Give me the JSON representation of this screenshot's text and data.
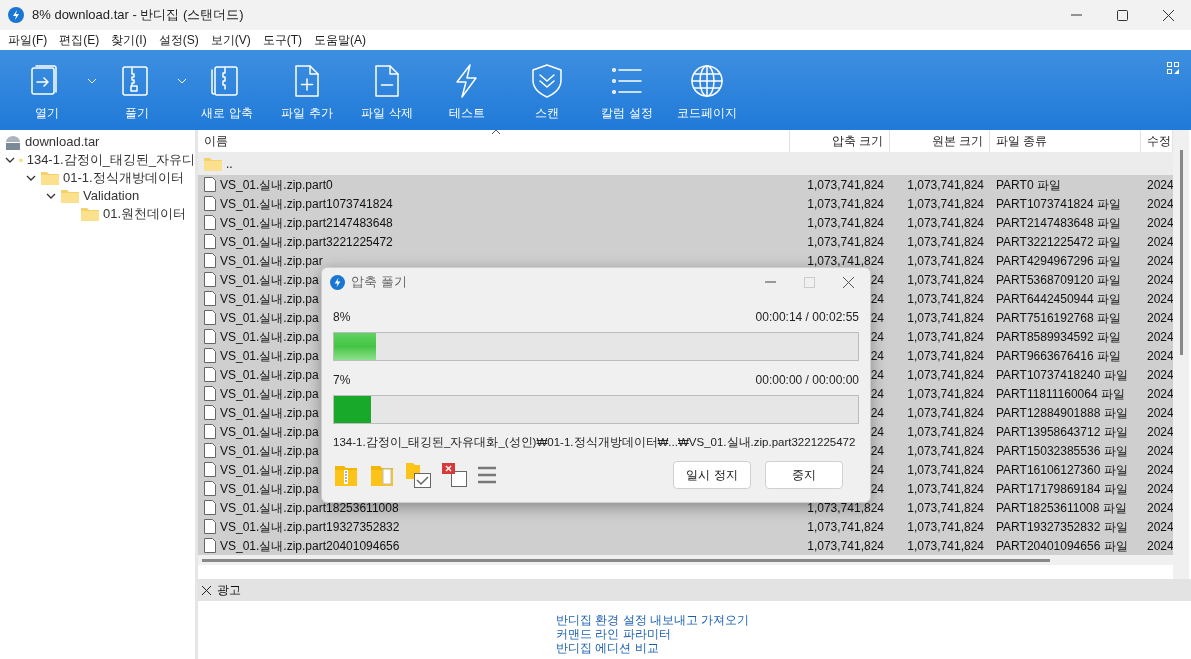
{
  "window": {
    "title": "8% download.tar - 반디집 (스탠더드)"
  },
  "menu": [
    "파일(F)",
    "편집(E)",
    "찾기(I)",
    "설정(S)",
    "보기(V)",
    "도구(T)",
    "도움말(A)"
  ],
  "toolbar": [
    {
      "kind": "open",
      "label": "열기",
      "dropdown": true
    },
    {
      "kind": "extract",
      "label": "풀기",
      "dropdown": true
    },
    {
      "kind": "new",
      "label": "새로 압축",
      "dropdown": false
    },
    {
      "kind": "add",
      "label": "파일 추가",
      "dropdown": false
    },
    {
      "kind": "delete",
      "label": "파일 삭제",
      "dropdown": false
    },
    {
      "kind": "test",
      "label": "테스트",
      "dropdown": false
    },
    {
      "kind": "scan",
      "label": "스캔",
      "dropdown": false
    },
    {
      "kind": "columns",
      "label": "칼럼 설정",
      "dropdown": false
    },
    {
      "kind": "codepage",
      "label": "코드페이지",
      "dropdown": false
    }
  ],
  "tree": {
    "label": "download.tar",
    "children": [
      {
        "label": "134-1.감정이_태깅된_자유디",
        "expanded": true,
        "children": [
          {
            "label": "01-1.정식개방데이터",
            "expanded": true,
            "children": [
              {
                "label": "Validation",
                "expanded": true,
                "children": [
                  {
                    "label": "01.원천데이터"
                  }
                ]
              }
            ]
          }
        ]
      }
    ]
  },
  "table": {
    "columns": [
      "이름",
      "압축 크기",
      "원본 크기",
      "파일 종류",
      "수정"
    ],
    "rows": [
      {
        "kind": "folder",
        "selected": false,
        "cells": [
          "..",
          "",
          "",
          "",
          ""
        ]
      },
      {
        "kind": "file",
        "selected": true,
        "cells": [
          "VS_01.실내.zip.part0",
          "1,073,741,824",
          "1,073,741,824",
          "PART0 파일",
          "2024"
        ]
      },
      {
        "kind": "file",
        "selected": true,
        "cells": [
          "VS_01.실내.zip.part1073741824",
          "1,073,741,824",
          "1,073,741,824",
          "PART1073741824 파일",
          "2024"
        ]
      },
      {
        "kind": "file",
        "selected": true,
        "cells": [
          "VS_01.실내.zip.part2147483648",
          "1,073,741,824",
          "1,073,741,824",
          "PART2147483648 파일",
          "2024"
        ]
      },
      {
        "kind": "file",
        "selected": true,
        "cells": [
          "VS_01.실내.zip.part3221225472",
          "1,073,741,824",
          "1,073,741,824",
          "PART3221225472 파일",
          "2024"
        ]
      },
      {
        "kind": "file",
        "selected": true,
        "cells": [
          "VS_01.실내.zip.par",
          "1,073,741,824",
          "1,073,741,824",
          "PART4294967296 파일",
          "2024"
        ]
      },
      {
        "kind": "file",
        "selected": true,
        "cells": [
          "VS_01.실내.zip.pa",
          "24",
          "1,073,741,824",
          "PART5368709120 파일",
          "2024"
        ]
      },
      {
        "kind": "file",
        "selected": true,
        "cells": [
          "VS_01.실내.zip.pa",
          "24",
          "1,073,741,824",
          "PART6442450944 파일",
          "2024"
        ]
      },
      {
        "kind": "file",
        "selected": true,
        "cells": [
          "VS_01.실내.zip.pa",
          "24",
          "1,073,741,824",
          "PART7516192768 파일",
          "2024"
        ]
      },
      {
        "kind": "file",
        "selected": true,
        "cells": [
          "VS_01.실내.zip.pa",
          "24",
          "1,073,741,824",
          "PART8589934592 파일",
          "2024"
        ]
      },
      {
        "kind": "file",
        "selected": true,
        "cells": [
          "VS_01.실내.zip.pa",
          "24",
          "1,073,741,824",
          "PART9663676416 파일",
          "2024"
        ]
      },
      {
        "kind": "file",
        "selected": true,
        "cells": [
          "VS_01.실내.zip.pa",
          "24",
          "1,073,741,824",
          "PART10737418240 파일",
          "2024"
        ]
      },
      {
        "kind": "file",
        "selected": true,
        "cells": [
          "VS_01.실내.zip.pa",
          "24",
          "1,073,741,824",
          "PART11811160064 파일",
          "2024"
        ]
      },
      {
        "kind": "file",
        "selected": true,
        "cells": [
          "VS_01.실내.zip.pa",
          "24",
          "1,073,741,824",
          "PART12884901888 파일",
          "2024"
        ]
      },
      {
        "kind": "file",
        "selected": true,
        "cells": [
          "VS_01.실내.zip.pa",
          "24",
          "1,073,741,824",
          "PART13958643712 파일",
          "2024"
        ]
      },
      {
        "kind": "file",
        "selected": true,
        "cells": [
          "VS_01.실내.zip.pa",
          "24",
          "1,073,741,824",
          "PART15032385536 파일",
          "2024"
        ]
      },
      {
        "kind": "file",
        "selected": true,
        "cells": [
          "VS_01.실내.zip.pa",
          "24",
          "1,073,741,824",
          "PART16106127360 파일",
          "2024"
        ]
      },
      {
        "kind": "file",
        "selected": true,
        "cells": [
          "VS_01.실내.zip.pa",
          "24",
          "1,073,741,824",
          "PART17179869184 파일",
          "2024"
        ]
      },
      {
        "kind": "file",
        "selected": true,
        "cells": [
          "VS_01.실내.zip.part18253611008",
          "1,073,741,824",
          "1,073,741,824",
          "PART18253611008 파일",
          "2024"
        ]
      },
      {
        "kind": "file",
        "selected": true,
        "cells": [
          "VS_01.실내.zip.part19327352832",
          "1,073,741,824",
          "1,073,741,824",
          "PART19327352832 파일",
          "2024"
        ]
      },
      {
        "kind": "file",
        "selected": true,
        "cells": [
          "VS_01.실내.zip.part20401094656",
          "1,073,741,824",
          "1,073,741,824",
          "PART20401094656 파일",
          "2024"
        ]
      }
    ]
  },
  "ad": {
    "title": "광고",
    "links": [
      "반디집 환경 설정 내보내고 가져오기",
      "커맨드 라인 파라미터",
      "반디집 에디션 비교"
    ]
  },
  "dialog": {
    "title": "압축 풀기",
    "progress": [
      {
        "percent": "8%",
        "time": "00:00:14 / 00:02:55",
        "level": 0.08
      },
      {
        "percent": "7%",
        "time": "00:00:00 / 00:00:00",
        "level": 0.07
      }
    ],
    "path": "134-1.감정이_태깅된_자유대화_(성인)₩01-1.정식개방데이터₩...₩VS_01.실내.zip.part3221225472",
    "buttons": [
      "일시 정지",
      "중지"
    ]
  }
}
